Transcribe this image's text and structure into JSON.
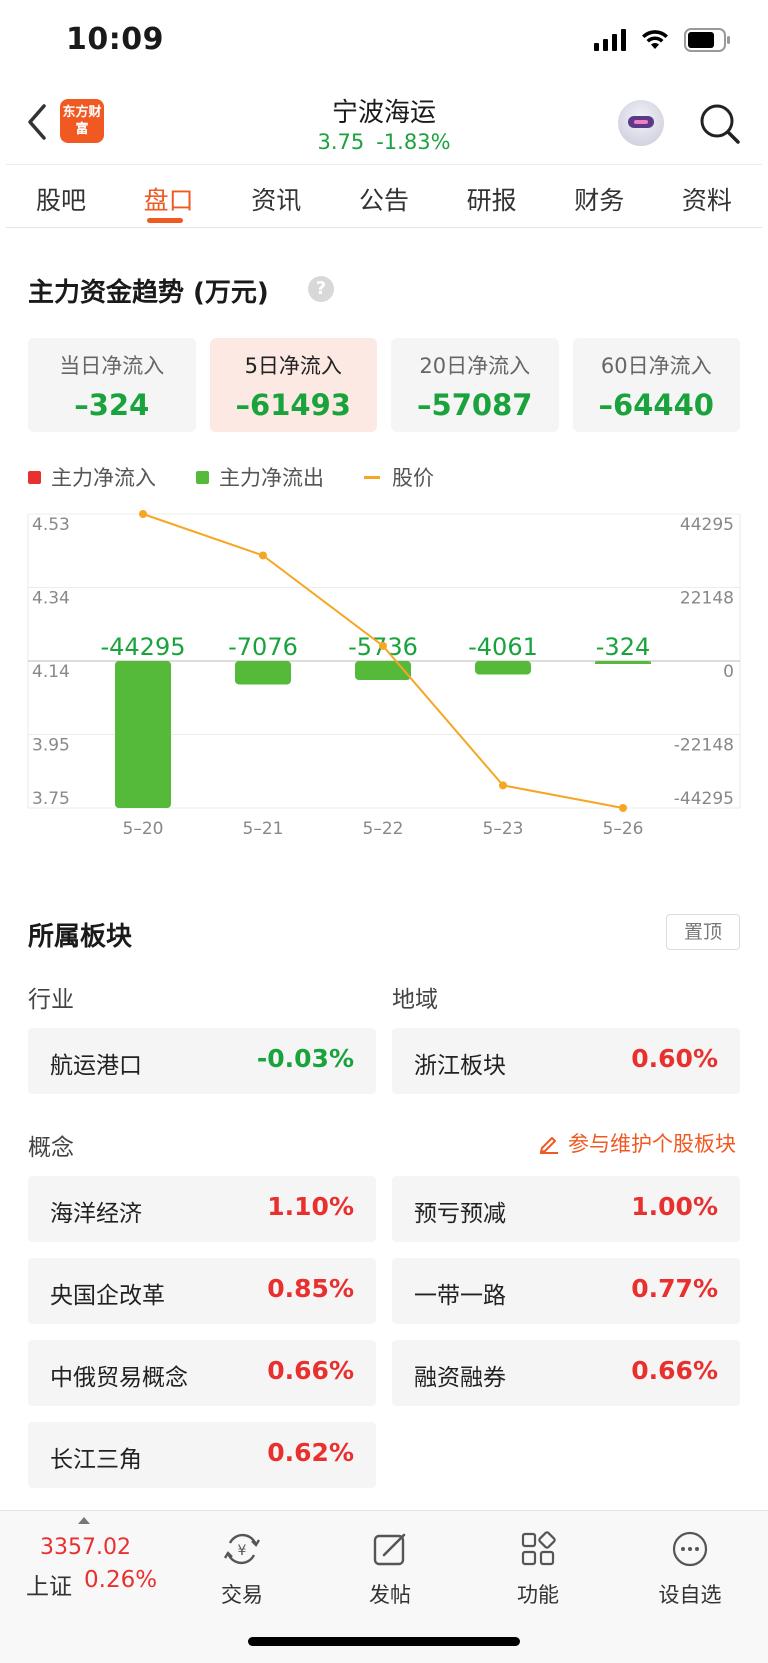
{
  "status": {
    "time": "10:09"
  },
  "header": {
    "logo_text": "东方财富",
    "stock_name": "宁波海运",
    "price": "3.75",
    "change_pct": "-1.83%"
  },
  "tabs": [
    {
      "label": "股吧"
    },
    {
      "label": "盘口"
    },
    {
      "label": "资讯"
    },
    {
      "label": "公告"
    },
    {
      "label": "研报"
    },
    {
      "label": "财务"
    },
    {
      "label": "资料"
    }
  ],
  "fund_flow": {
    "title": "主力资金趋势 (万元)",
    "help_glyph": "?",
    "cards": [
      {
        "label": "当日净流入",
        "value": "–324"
      },
      {
        "label": "5日净流入",
        "value": "–61493"
      },
      {
        "label": "20日净流入",
        "value": "–57087"
      },
      {
        "label": "60日净流入",
        "value": "–64440"
      }
    ],
    "legend": {
      "inflow": "主力净流入",
      "outflow": "主力净流出",
      "price": "股价"
    },
    "colors": {
      "inflow": "#e8312f",
      "outflow": "#55b93a",
      "price": "#f5a623"
    }
  },
  "chart_data": {
    "type": "bar",
    "title": "",
    "categories": [
      "5–20",
      "5–21",
      "5–22",
      "5–23",
      "5–26"
    ],
    "series": [
      {
        "name": "主力净流入/流出",
        "values": [
          -44295,
          -7076,
          -5736,
          -4061,
          -324
        ]
      },
      {
        "name": "股价",
        "values": [
          4.53,
          4.42,
          4.18,
          3.81,
          3.75
        ]
      }
    ],
    "bar_labels": [
      "-44295",
      "-7076",
      "-5736",
      "-4061",
      "-324"
    ],
    "left_ticks": [
      "4.53",
      "4.34",
      "4.14",
      "3.95",
      "3.75"
    ],
    "right_ticks": [
      "44295",
      "22148",
      "0",
      "-22148",
      "-44295"
    ],
    "left_range": [
      3.75,
      4.53
    ],
    "right_range": [
      -44295,
      44295
    ],
    "grid": true
  },
  "sectors": {
    "title": "所属板块",
    "pin_label": "置顶",
    "industry_label": "行业",
    "region_label": "地域",
    "concept_label": "概念",
    "maintain_label": "参与维护个股板块",
    "industry": {
      "name": "航运港口",
      "pct": "-0.03%"
    },
    "region": {
      "name": "浙江板块",
      "pct": "0.60%"
    },
    "concepts": [
      {
        "name": "海洋经济",
        "pct": "1.10%"
      },
      {
        "name": "预亏预减",
        "pct": "1.00%"
      },
      {
        "name": "央国企改革",
        "pct": "0.85%"
      },
      {
        "name": "一带一路",
        "pct": "0.77%"
      },
      {
        "name": "中俄贸易概念",
        "pct": "0.66%"
      },
      {
        "name": "融资融券",
        "pct": "0.66%"
      },
      {
        "name": "长江三角",
        "pct": "0.62%"
      }
    ]
  },
  "bottom_bar": {
    "index_value": "3357.02",
    "index_name": "上证",
    "index_pct": "0.26%",
    "nav": [
      {
        "label": "交易",
        "icon": "trade-yen-icon"
      },
      {
        "label": "发帖",
        "icon": "compose-icon"
      },
      {
        "label": "功能",
        "icon": "grid-icon"
      },
      {
        "label": "设自选",
        "icon": "more-dots-icon"
      }
    ]
  }
}
